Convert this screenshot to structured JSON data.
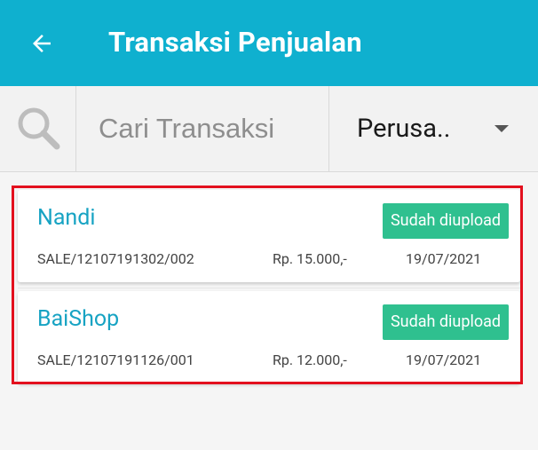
{
  "header": {
    "title": "Transaksi Penjualan",
    "back_icon": "arrow-left-icon"
  },
  "search": {
    "placeholder": "Cari Transaksi",
    "icon": "search-icon"
  },
  "filter": {
    "selected": "Perusa..",
    "icon": "caret-down-icon"
  },
  "colors": {
    "appbar": "#0fb0cf",
    "name_text": "#17a3c3",
    "badge": "#2fc08f",
    "highlight_border": "#e3101e"
  },
  "transactions": [
    {
      "name": "Nandi",
      "status": "Sudah diupload",
      "code": "SALE/12107191302/002",
      "amount": "Rp. 15.000,-",
      "date": "19/07/2021"
    },
    {
      "name": "BaiShop",
      "status": "Sudah diupload",
      "code": "SALE/12107191126/001",
      "amount": "Rp. 12.000,-",
      "date": "19/07/2021"
    }
  ]
}
